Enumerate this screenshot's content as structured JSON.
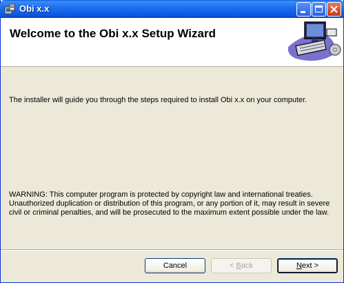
{
  "window": {
    "title": "Obi x.x",
    "controls": {
      "minimize": "minimize-icon",
      "maximize": "maximize-icon",
      "close": "close-icon"
    }
  },
  "banner": {
    "title": "Welcome to the Obi x.x Setup Wizard",
    "art": "computer-setup-icon"
  },
  "body": {
    "intro": "The installer will guide you through the steps required to install Obi x.x on your computer.",
    "warning": "WARNING: This computer program is protected by copyright law and international treaties. Unauthorized duplication or distribution of this program, or any portion of it, may result in severe civil or criminal penalties, and will be prosecuted to the maximum extent possible under the law."
  },
  "buttons": {
    "cancel": "Cancel",
    "back_prefix": "< ",
    "back_mnemonic": "B",
    "back_rest": "ack",
    "next_mnemonic": "N",
    "next_rest": "ext >"
  },
  "colors": {
    "titlebar": "#0a58e0",
    "dialog_bg": "#ece9d8",
    "banner_bg": "#ffffff"
  }
}
